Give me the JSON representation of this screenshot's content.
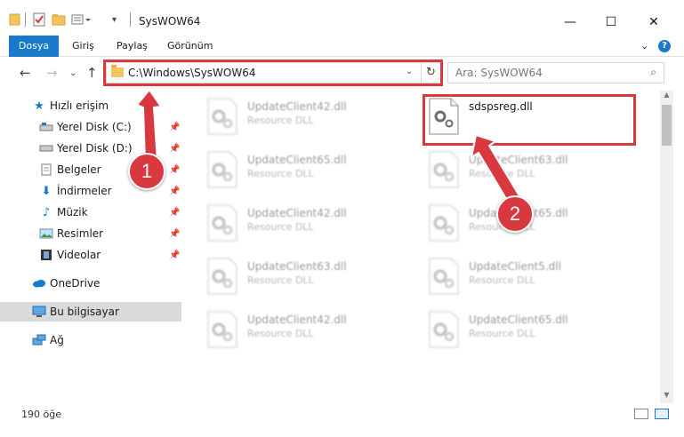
{
  "window": {
    "title": "SysWOW64",
    "minimize_icon": "minimize-icon",
    "maximize_icon": "maximize-icon",
    "close_icon": "close-icon"
  },
  "ribbon": {
    "tabs": [
      {
        "label": "Dosya",
        "active": true
      },
      {
        "label": "Giriş",
        "active": false
      },
      {
        "label": "Paylaş",
        "active": false
      },
      {
        "label": "Görünüm",
        "active": false
      }
    ],
    "help_label": "?"
  },
  "address": {
    "path": "C:\\Windows\\SysWOW64",
    "search_placeholder": "Ara: SysWOW64"
  },
  "sidebar": {
    "quick_access": "Hızlı erişim",
    "items": [
      {
        "label": "Yerel Disk (C:)",
        "icon": "drive-icon"
      },
      {
        "label": "Yerel Disk (D:)",
        "icon": "drive-icon"
      },
      {
        "label": "Belgeler",
        "icon": "documents-icon"
      },
      {
        "label": "İndirmeler",
        "icon": "download-icon"
      },
      {
        "label": "Müzik",
        "icon": "music-icon"
      },
      {
        "label": "Resimler",
        "icon": "pictures-icon"
      },
      {
        "label": "Videolar",
        "icon": "videos-icon"
      }
    ],
    "onedrive": "OneDrive",
    "this_pc": "Bu bilgisayar",
    "network": "Ağ"
  },
  "files": [
    {
      "name": "UpdateClient42.dll",
      "type": "Resource DLL"
    },
    {
      "name": "sdspsreg.dll",
      "type": ""
    },
    {
      "name": "UpdateClient65.dll",
      "type": "Resource DLL"
    },
    {
      "name": "UpdateClient63.dll",
      "type": "Resource DLL"
    },
    {
      "name": "UpdateClient42.dll",
      "type": "Resource DLL"
    },
    {
      "name": "UpdateClient65.dll",
      "type": "Resource DLL"
    },
    {
      "name": "UpdateClient63.dll",
      "type": "Resource DLL"
    },
    {
      "name": "UpdateClient5.dll",
      "type": "Resource DLL"
    },
    {
      "name": "UpdateClient42.dll",
      "type": "Resource DLL"
    },
    {
      "name": "UpdateClient65.dll",
      "type": "Resource DLL"
    }
  ],
  "status": {
    "item_count": "190 öğe"
  },
  "callouts": {
    "first": "1",
    "second": "2"
  },
  "colors": {
    "accent": "#1979ca",
    "highlight": "#d7393f",
    "folder": "#f2c55c"
  }
}
